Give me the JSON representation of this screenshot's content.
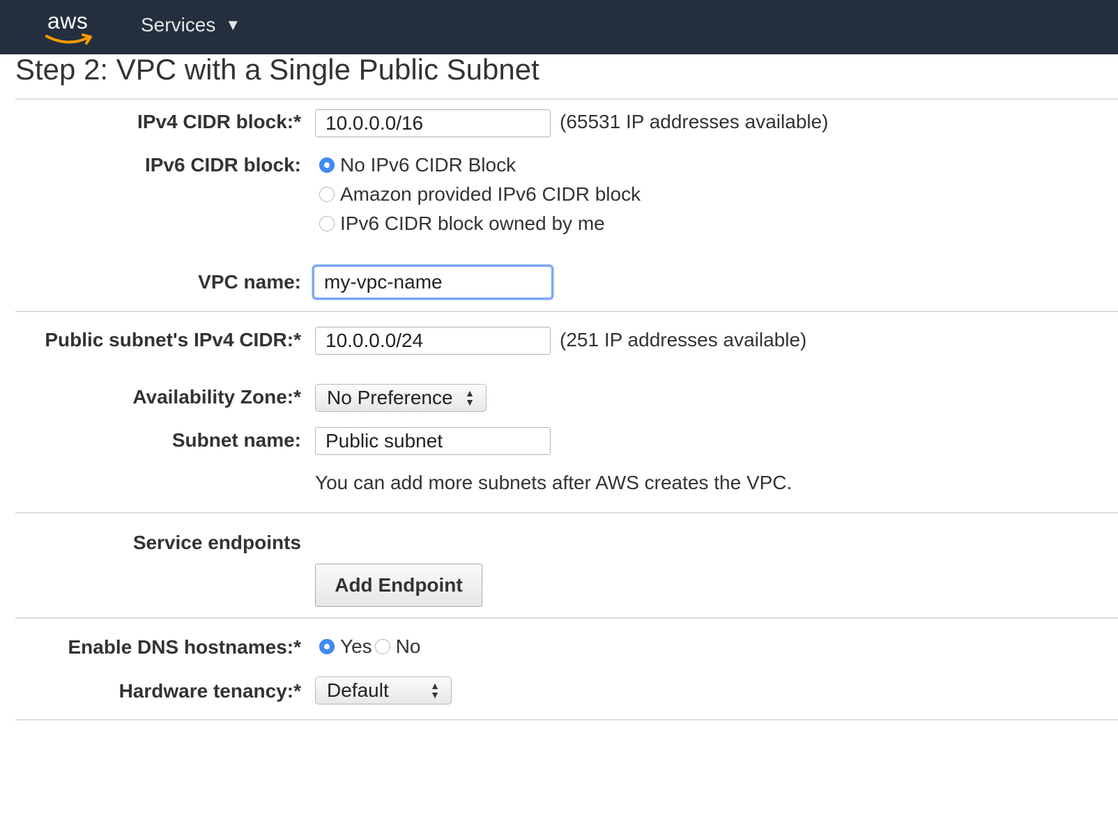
{
  "header": {
    "logo_text": "aws",
    "services_label": "Services",
    "services_caret": "▼"
  },
  "page_title": "Step 2: VPC with a Single Public Subnet",
  "ipv4_cidr": {
    "label": "IPv4 CIDR block:*",
    "value": "10.0.0.0/16",
    "hint": "(65531 IP addresses available)"
  },
  "ipv6_cidr": {
    "label": "IPv6 CIDR block:",
    "options": [
      {
        "label": "No IPv6 CIDR Block",
        "selected": true
      },
      {
        "label": "Amazon provided IPv6 CIDR block",
        "selected": false
      },
      {
        "label": "IPv6 CIDR block owned by me",
        "selected": false
      }
    ]
  },
  "vpc_name": {
    "label": "VPC name:",
    "value": "my-vpc-name"
  },
  "public_subnet_cidr": {
    "label": "Public subnet's IPv4 CIDR:*",
    "value": "10.0.0.0/24",
    "hint": "(251 IP addresses available)"
  },
  "availability_zone": {
    "label": "Availability Zone:*",
    "value": "No Preference"
  },
  "subnet_name": {
    "label": "Subnet name:",
    "value": "Public subnet",
    "note": "You can add more subnets after AWS creates the VPC."
  },
  "service_endpoints": {
    "label": "Service endpoints",
    "button_label": "Add Endpoint"
  },
  "dns_hostnames": {
    "label": "Enable DNS hostnames:*",
    "options": [
      {
        "label": "Yes",
        "selected": true
      },
      {
        "label": "No",
        "selected": false
      }
    ]
  },
  "hardware_tenancy": {
    "label": "Hardware tenancy:*",
    "value": "Default"
  },
  "colors": {
    "topbar": "#232f3e",
    "aws_smile": "#ff9900",
    "radio_selected": "#3f8cf3",
    "focus_ring": "#7da7f5"
  }
}
